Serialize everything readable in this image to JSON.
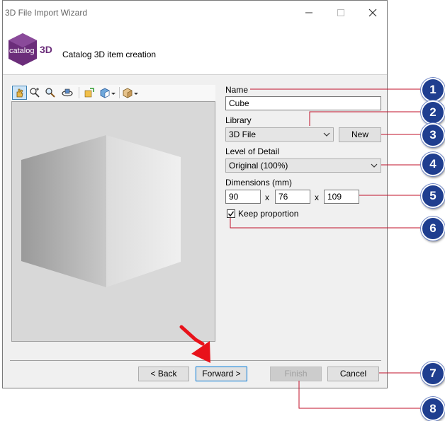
{
  "window": {
    "title": "3D File Import Wizard",
    "minimize_icon": "minimize-icon",
    "maximize_icon": "maximize-icon",
    "close_icon": "close-icon"
  },
  "header": {
    "logo_text": "catalog",
    "logo_suffix": "3D",
    "subtitle": "Catalog 3D item creation"
  },
  "toolbar": {
    "icons": [
      "pan-icon",
      "zoom-window-icon",
      "zoom-icon",
      "rotate-icon",
      "orient-icon",
      "view-cube-icon",
      "box-icon"
    ]
  },
  "form": {
    "name_label": "Name",
    "name_value": "Cube",
    "library_label": "Library",
    "library_value": "3D File",
    "new_button": "New",
    "lod_label": "Level of Detail",
    "lod_value": "Original (100%)",
    "dimensions_label": "Dimensions (mm)",
    "dim_x": "90",
    "dim_y": "76",
    "dim_z": "109",
    "dim_sep": "x",
    "keep_proportion_label": "Keep proportion",
    "keep_proportion_checked": true
  },
  "buttons": {
    "back": "< Back",
    "forward": "Forward >",
    "finish": "Finish",
    "cancel": "Cancel"
  },
  "callouts": [
    "1",
    "2",
    "3",
    "4",
    "5",
    "6",
    "7",
    "8"
  ],
  "colors": {
    "callout_fill": "#1f3e8f",
    "callout_line": "#c0102a",
    "arrow": "#e8121a",
    "logo_purple": "#6b2d7a"
  }
}
